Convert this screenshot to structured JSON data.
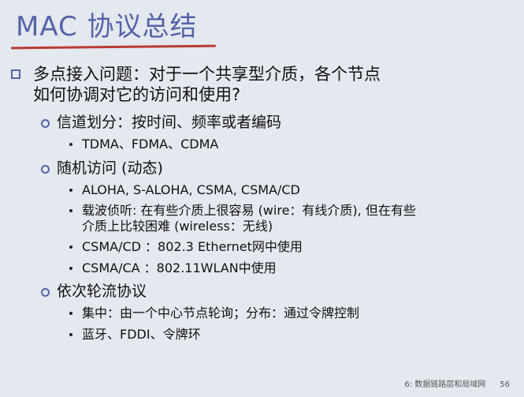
{
  "title": "MAC 协议总结",
  "q_line1": "多点接入问题：对于一个共享型介质，各个节点",
  "q_line2": "如何协调对它的访问和使用?",
  "channel_partition": {
    "heading": "信道划分：按时间、频率或者编码",
    "items": [
      "TDMA、FDMA、CDMA"
    ]
  },
  "random_access": {
    "heading": "随机访问 (动态)",
    "items": [
      "ALOHA, S-ALOHA, CSMA, CSMA/CD",
      "载波侦听: 在有些介质上很容易 (wire：有线介质), 但在有些",
      "介质上比较困难 (wireless：无线)",
      "CSMA/CD ：802.3 Ethernet网中使用",
      "CSMA/CA ：802.11WLAN中使用"
    ]
  },
  "taking_turns": {
    "heading": "依次轮流协议",
    "items": [
      "集中：由一个中心节点轮询；分布：通过令牌控制",
      "蓝牙、FDDI、令牌环"
    ]
  },
  "footer": {
    "chapter": "6: 数据链路层和局域网",
    "page": "56"
  }
}
